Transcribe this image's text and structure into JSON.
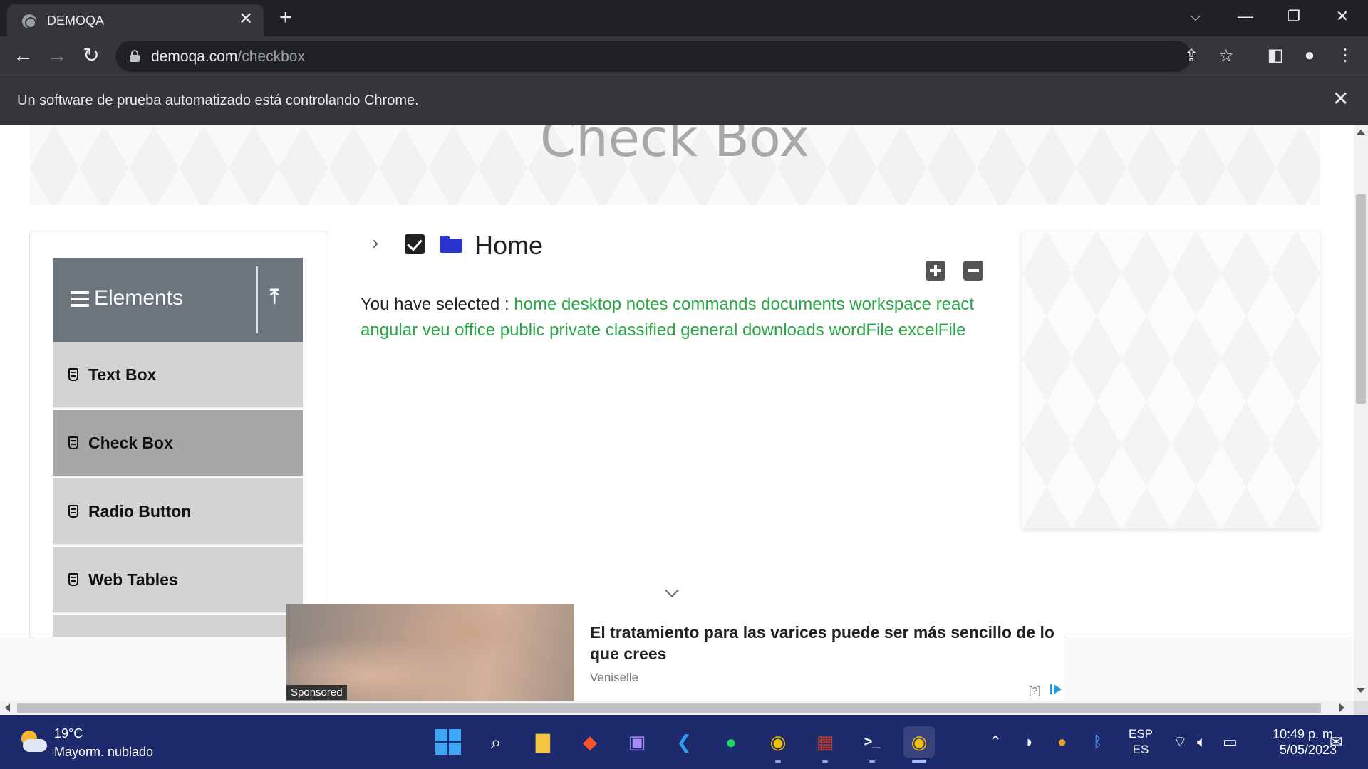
{
  "browser": {
    "tab_title": "DEMOQA",
    "url_host": "demoqa.com",
    "url_path": "/checkbox",
    "infobar_text": "Un software de prueba automatizado está controlando Chrome."
  },
  "page": {
    "banner_title": "Check Box",
    "sidebar": {
      "group_title": "Elements",
      "items": [
        {
          "label": "Text Box",
          "active": false
        },
        {
          "label": "Check Box",
          "active": true
        },
        {
          "label": "Radio Button",
          "active": false
        },
        {
          "label": "Web Tables",
          "active": false
        }
      ]
    },
    "tree": {
      "root_label": "Home",
      "checked": true,
      "expanded": false
    },
    "result": {
      "prefix": "You have selected :",
      "selected": [
        "home",
        "desktop",
        "notes",
        "commands",
        "documents",
        "workspace",
        "react",
        "angular",
        "veu",
        "office",
        "public",
        "private",
        "classified",
        "general",
        "downloads",
        "wordFile",
        "excelFile"
      ]
    },
    "ad": {
      "sponsored_label": "Sponsored",
      "headline": "El tratamiento para las varices puede ser más sencillo de lo que crees",
      "source": "Veniselle",
      "info": "[?]"
    }
  },
  "taskbar": {
    "weather_temp": "19°C",
    "weather_desc": "Mayorm. nublado",
    "lang_top": "ESP",
    "lang_bottom": "ES",
    "time": "10:49 p. m.",
    "date": "5/05/2023",
    "apps": [
      "start",
      "search",
      "file-explorer",
      "brave",
      "app",
      "vscode",
      "spotify",
      "chrome",
      "winrar",
      "terminal",
      "chrome-active"
    ]
  },
  "colors": {
    "selected_text": "#28a745",
    "sidebar_header": "#6c757d",
    "sidebar_item": "#d3d3d3",
    "sidebar_item_active": "#a7a7a7",
    "taskbar": "#1d2a6b"
  }
}
